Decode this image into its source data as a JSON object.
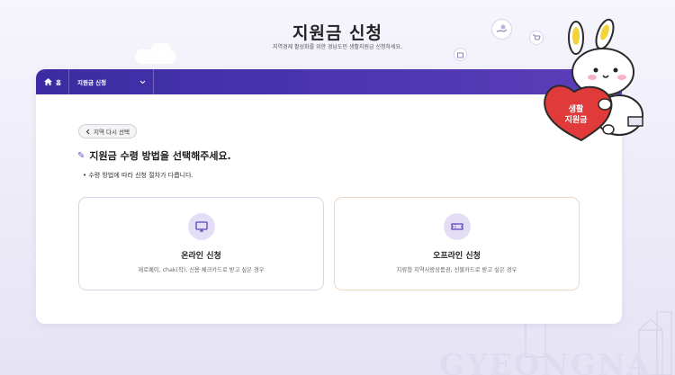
{
  "header": {
    "title": "지원금 신청",
    "subtitle": "지역경제 활성화를 위한 경남도민 생활지원금 신청하세요."
  },
  "nav": {
    "home_label": "홈",
    "dropdown_label": "지원금 신청"
  },
  "main": {
    "reselect_label": "지역 다시 선택",
    "question": "지원금 수령 방법을 선택해주세요.",
    "note": "수령 방법에 따라 신청 절차가 다릅니다."
  },
  "options": [
    {
      "title": "온라인 신청",
      "desc": "제로페이, chak(착), 신용·체크카드로 받고 싶은 경우",
      "icon": "monitor-icon"
    },
    {
      "title": "오프라인 신청",
      "desc": "지류형 지역사랑상품권, 선불카드로 받고 싶은 경우",
      "icon": "ticket-icon"
    }
  ],
  "mascot": {
    "heart_text_line1": "생활",
    "heart_text_line2": "지원금"
  },
  "decor": {
    "watermark": "GYEONGNA"
  },
  "colors": {
    "nav_bg": "#3b2ca3",
    "accent": "#6a4fd0",
    "icon_bg": "#e3def6",
    "heart": "#e03a3a"
  }
}
